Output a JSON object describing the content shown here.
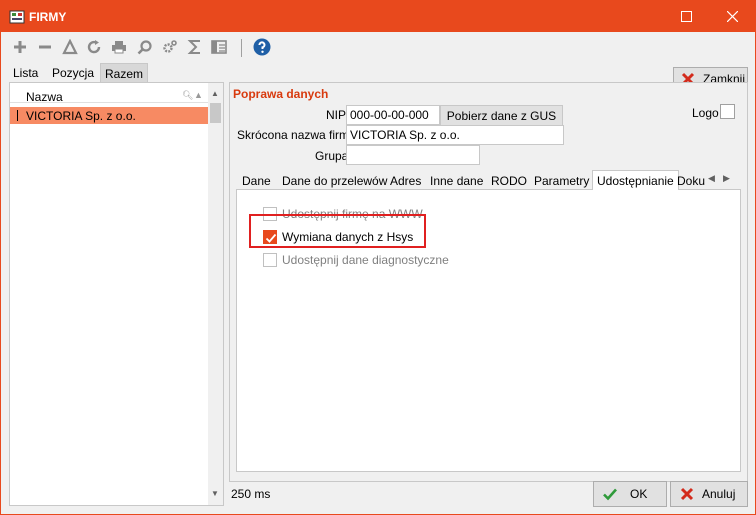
{
  "window": {
    "title": "FIRMY",
    "maximize_icon": "maximize-icon",
    "close_icon": "close-icon"
  },
  "toolbar": {
    "icons": [
      "add-icon",
      "remove-icon",
      "filter-icon",
      "refresh-icon",
      "print-icon",
      "search-icon",
      "settings-icon",
      "sum-icon",
      "columns-icon",
      "help-icon"
    ],
    "close_label": "Zamknij"
  },
  "top_tabs": [
    "Lista",
    "Pozycja",
    "Razem"
  ],
  "list": {
    "header": "Nazwa",
    "rows": [
      "VICTORIA Sp. z o.o."
    ]
  },
  "form": {
    "section_title": "Poprawa danych",
    "logo_label": "Logo",
    "nip_label": "NIP",
    "nip_value": "000-00-00-000",
    "gus_button": "Pobierz dane z GUS",
    "short_name_label": "Skrócona nazwa firmy",
    "short_name_value": "VICTORIA Sp. z o.o.",
    "group_label": "Grupa",
    "group_value": ""
  },
  "inner_tabs": [
    "Dane",
    "Dane do przelewów",
    "Adres",
    "Inne dane",
    "RODO",
    "Parametry",
    "Udostępnianie",
    "Doku"
  ],
  "active_inner_tab": "Udostępnianie",
  "sharing": {
    "items": [
      {
        "label": "Udostępnij firmę na WWW",
        "checked": false,
        "disabled": true
      },
      {
        "label": "Wymiana danych z Hsys",
        "checked": true,
        "disabled": false
      },
      {
        "label": "Udostępnij dane diagnostyczne",
        "checked": false,
        "disabled": true
      }
    ]
  },
  "footer": {
    "time": "250 ms",
    "ok_label": "OK",
    "cancel_label": "Anuluj"
  },
  "colors": {
    "accent": "#e8491d",
    "selection": "#f78a63",
    "section_title": "#d83a0e",
    "highlight_border": "#e02020"
  }
}
